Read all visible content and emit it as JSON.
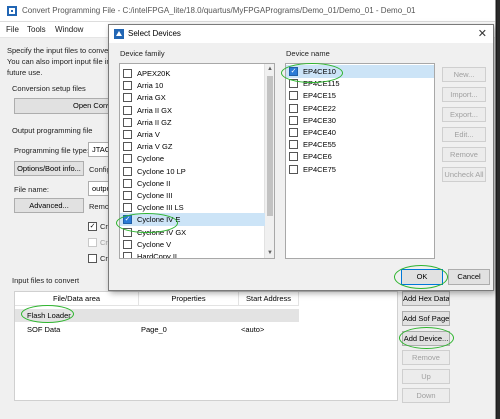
{
  "main": {
    "title": "Convert Programming File - C:/intelFPGA_lite/18.0/quartus/MyFPGAPrograms/Demo_01/Demo_01 - Demo_01",
    "menu": [
      "File",
      "Tools",
      "Window"
    ],
    "intro_lines": [
      "Specify the input files to convert",
      "You can also import input file in",
      "future use."
    ],
    "conversion_setup_label": "Conversion setup files",
    "open_button": "Open Conv",
    "output_file_label": "Output programming file",
    "file_type_label": "Programming file type:",
    "file_type_value": "JTAG",
    "options_button": "Options/Boot info...",
    "config_label": "Configu",
    "file_name_label": "File name:",
    "file_name_value": "outpu",
    "advanced_button": "Advanced...",
    "remote_label": "Remo",
    "opt1": "Cr",
    "opt2": "Cr",
    "opt3": "Cr",
    "input_files_label": "Input files to convert",
    "table": {
      "headers": [
        "File/Data area",
        "Properties",
        "Start Address"
      ],
      "rows": [
        {
          "file": "Flash Loader",
          "props": "",
          "addr": ""
        },
        {
          "file": "SOF Data",
          "props": "Page_0",
          "addr": "<auto>"
        }
      ]
    },
    "side_buttons": [
      "Add Hex Data",
      "Add Sof Page",
      "Add Device...",
      "Remove",
      "Up",
      "Down"
    ]
  },
  "dialog": {
    "title": "Select Devices",
    "family_label": "Device family",
    "name_label": "Device name",
    "families": [
      {
        "label": "APEX20K",
        "checked": false
      },
      {
        "label": "Arria 10",
        "checked": false
      },
      {
        "label": "Arria GX",
        "checked": false
      },
      {
        "label": "Arria II GX",
        "checked": false
      },
      {
        "label": "Arria II GZ",
        "checked": false
      },
      {
        "label": "Arria V",
        "checked": false
      },
      {
        "label": "Arria V GZ",
        "checked": false
      },
      {
        "label": "Cyclone",
        "checked": false
      },
      {
        "label": "Cyclone 10 LP",
        "checked": false
      },
      {
        "label": "Cyclone II",
        "checked": false
      },
      {
        "label": "Cyclone III",
        "checked": false
      },
      {
        "label": "Cyclone III LS",
        "checked": false
      },
      {
        "label": "Cyclone IV E",
        "checked": true
      },
      {
        "label": "Cyclone IV GX",
        "checked": false
      },
      {
        "label": "Cyclone V",
        "checked": false
      },
      {
        "label": "HardCopy II",
        "checked": false
      }
    ],
    "devices": [
      {
        "label": "EP4CE10",
        "checked": true
      },
      {
        "label": "EP4CE115",
        "checked": false
      },
      {
        "label": "EP4CE15",
        "checked": false
      },
      {
        "label": "EP4CE22",
        "checked": false
      },
      {
        "label": "EP4CE30",
        "checked": false
      },
      {
        "label": "EP4CE40",
        "checked": false
      },
      {
        "label": "EP4CE55",
        "checked": false
      },
      {
        "label": "EP4CE6",
        "checked": false
      },
      {
        "label": "EP4CE75",
        "checked": false
      }
    ],
    "buttons": [
      "New...",
      "Import...",
      "Export...",
      "Edit...",
      "Remove",
      "Uncheck All"
    ],
    "ok": "OK",
    "cancel": "Cancel"
  },
  "colors": {
    "annotation": "#2fb52f",
    "check_blue": "#2a7bd6",
    "selection": "#cce4f7"
  }
}
